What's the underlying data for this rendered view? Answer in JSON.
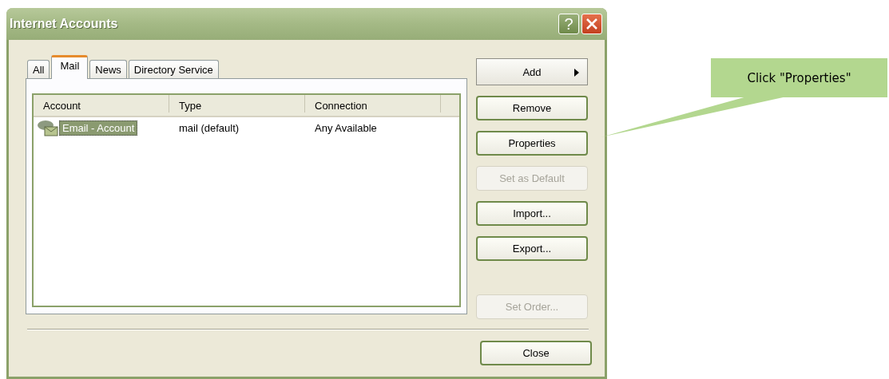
{
  "window": {
    "title": "Internet Accounts",
    "help_button": "?"
  },
  "tabs": [
    {
      "label": "All",
      "selected": false
    },
    {
      "label": "Mail",
      "selected": true
    },
    {
      "label": "News",
      "selected": false
    },
    {
      "label": "Directory Service",
      "selected": false
    }
  ],
  "table": {
    "columns": [
      "Account",
      "Type",
      "Connection"
    ],
    "rows": [
      {
        "cells": [
          "Email - Account",
          "mail (default)",
          "Any Available"
        ],
        "selected": true
      }
    ]
  },
  "side_buttons": [
    {
      "label": "Add",
      "kind": "menu",
      "disabled": false
    },
    {
      "label": "Remove",
      "kind": "push",
      "disabled": false
    },
    {
      "label": "Properties",
      "kind": "push",
      "disabled": false
    },
    {
      "label": "Set as Default",
      "kind": "push",
      "disabled": true
    },
    {
      "label": "Import...",
      "kind": "push",
      "disabled": false
    },
    {
      "label": "Export...",
      "kind": "push",
      "disabled": false
    },
    {
      "label": "Set Order...",
      "kind": "push",
      "disabled": true
    }
  ],
  "footer_buttons": [
    {
      "label": "Close",
      "disabled": false
    }
  ],
  "callout": {
    "text": "Click \"Properties\""
  }
}
